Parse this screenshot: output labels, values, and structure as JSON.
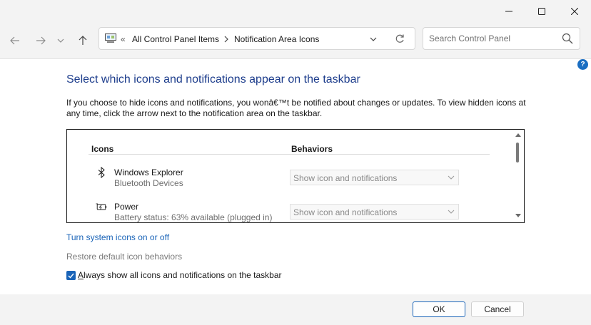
{
  "navbar": {
    "breadcrumb_prefix": "«",
    "breadcrumb": [
      "All Control Panel Items",
      "Notification Area Icons"
    ],
    "search_placeholder": "Search Control Panel"
  },
  "help_label": "?",
  "content": {
    "heading": "Select which icons and notifications appear on the taskbar",
    "description": "If you choose to hide icons and notifications, you wonâ€™t be notified about changes or updates. To view hidden icons at any time, click the arrow next to the notification area on the taskbar.",
    "table": {
      "columns": [
        "Icons",
        "Behaviors"
      ],
      "rows": [
        {
          "icon": "bluetooth-icon",
          "name": "Windows Explorer",
          "sub": "Bluetooth Devices",
          "behavior": "Show icon and notifications"
        },
        {
          "icon": "battery-charging-icon",
          "name": "Power",
          "sub": "Battery status: 63% available (plugged in)",
          "behavior": "Show icon and notifications"
        }
      ]
    },
    "link_system_icons": "Turn system icons on or off",
    "link_restore": "Restore default icon behaviors",
    "checkbox": {
      "label_underline": "A",
      "label_rest": "lways show all icons and notifications on the taskbar",
      "checked": true
    }
  },
  "buttons": {
    "ok": "OK",
    "cancel": "Cancel"
  },
  "colors": {
    "link": "#1a64b8",
    "heading": "#1d3d8c",
    "accent": "#1a64b8",
    "disabled_text": "#7a7a7a"
  }
}
